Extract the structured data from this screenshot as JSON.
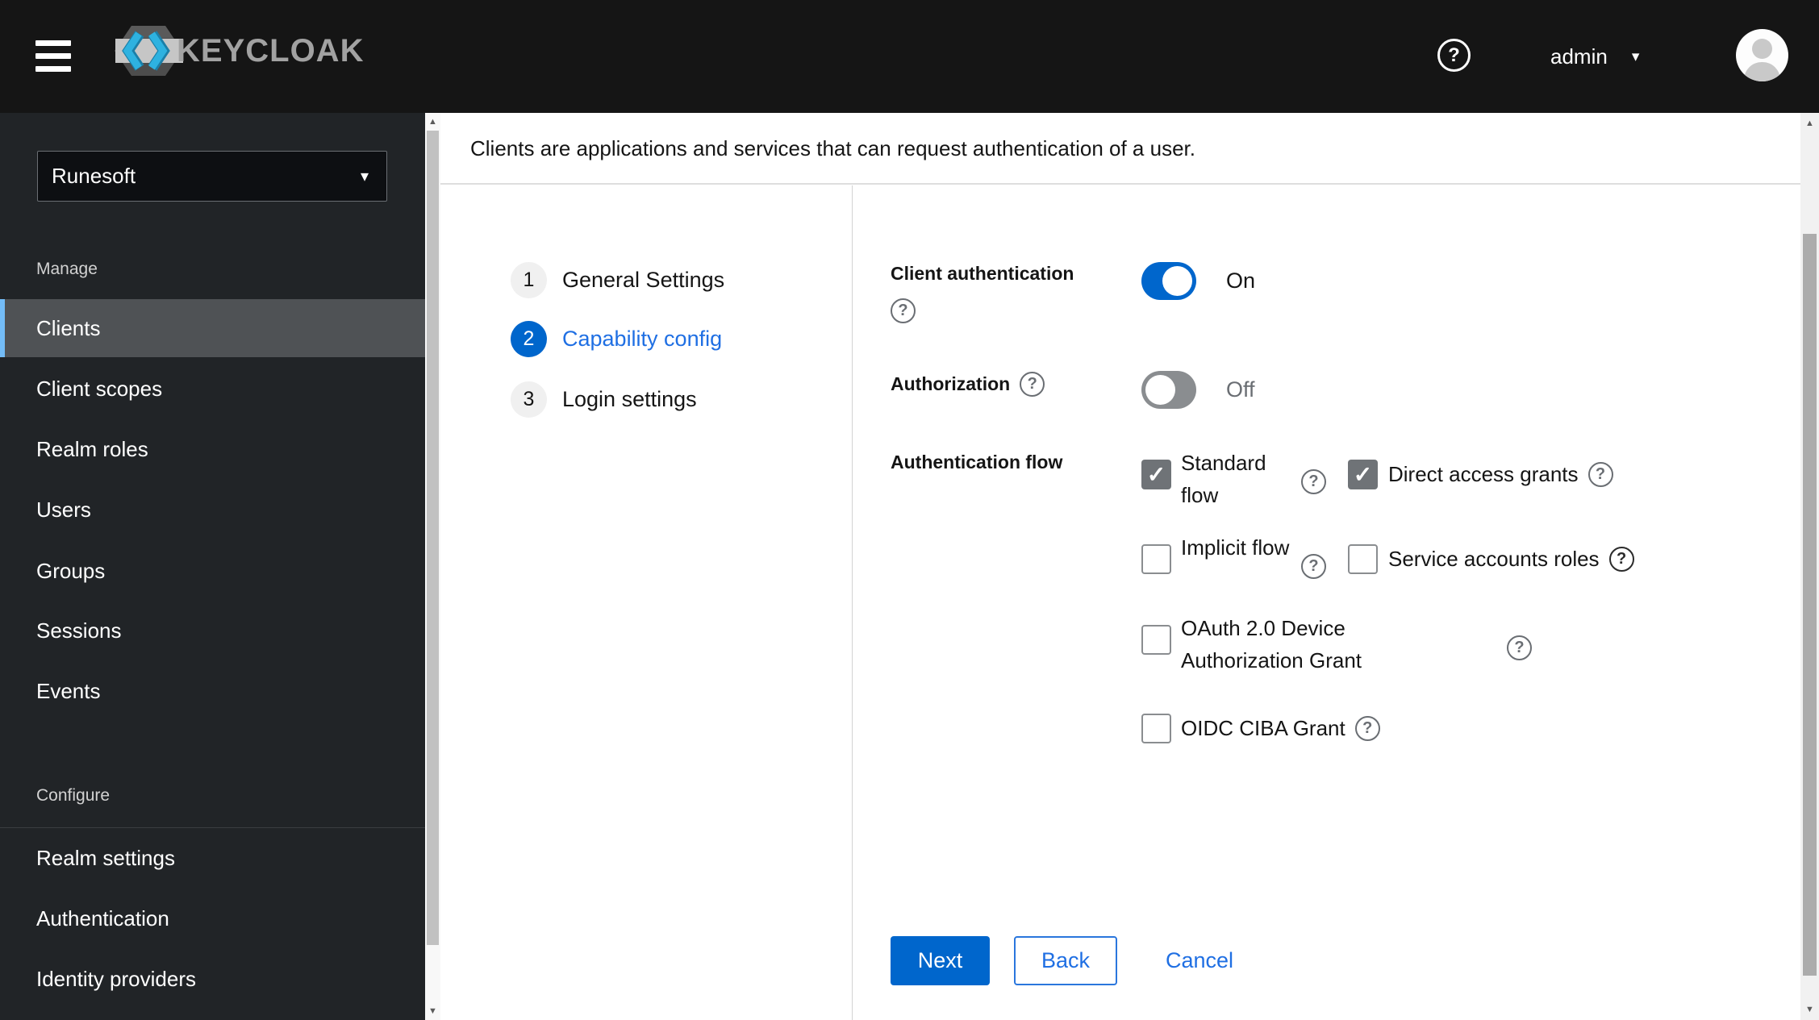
{
  "colors": {
    "accent": "#0066cc",
    "link_blue": "#1f6fe3",
    "header_bg": "#151515",
    "sidebar_bg": "#212427",
    "sidebar_selected_bg": "#4f5255",
    "sidebar_selected_indicator": "#73bcf7",
    "checkbox_checked": "#6f7377",
    "toggle_off": "#8a8d90"
  },
  "icons": {
    "check": "✓",
    "question": "?",
    "caret_down": "▾",
    "arrow_up": "▲",
    "arrow_down": "▼"
  },
  "header": {
    "brand": "KEYCLOAK",
    "user": "admin"
  },
  "sidebar": {
    "realm_selector": {
      "value": "Runesoft"
    },
    "sections": [
      {
        "label": "Manage",
        "items": [
          {
            "label": "Clients",
            "selected": true
          },
          {
            "label": "Client scopes"
          },
          {
            "label": "Realm roles"
          },
          {
            "label": "Users"
          },
          {
            "label": "Groups"
          },
          {
            "label": "Sessions"
          },
          {
            "label": "Events"
          }
        ]
      },
      {
        "label": "Configure",
        "items": [
          {
            "label": "Realm settings"
          },
          {
            "label": "Authentication"
          },
          {
            "label": "Identity providers"
          }
        ]
      }
    ]
  },
  "main": {
    "subtitle": "Clients are applications and services that can request authentication of a user.",
    "wizard": {
      "steps": [
        {
          "num": "1",
          "label": "General Settings",
          "current": false
        },
        {
          "num": "2",
          "label": "Capability config",
          "current": true
        },
        {
          "num": "3",
          "label": "Login settings",
          "current": false
        }
      ]
    },
    "form": {
      "client_authentication": {
        "label": "Client authentication",
        "state": "On"
      },
      "authorization": {
        "label": "Authorization",
        "state": "Off"
      },
      "authentication_flow": {
        "label": "Authentication flow",
        "options": [
          {
            "label": "Standard flow",
            "checked": true
          },
          {
            "label": "Direct access grants",
            "checked": true
          },
          {
            "label": "Implicit flow",
            "checked": false
          },
          {
            "label": "Service accounts roles",
            "checked": false
          },
          {
            "label": "OAuth 2.0 Device Authorization Grant",
            "checked": false
          },
          {
            "label": "OIDC CIBA Grant",
            "checked": false
          }
        ]
      },
      "actions": {
        "next": "Next",
        "back": "Back",
        "cancel": "Cancel"
      }
    }
  }
}
